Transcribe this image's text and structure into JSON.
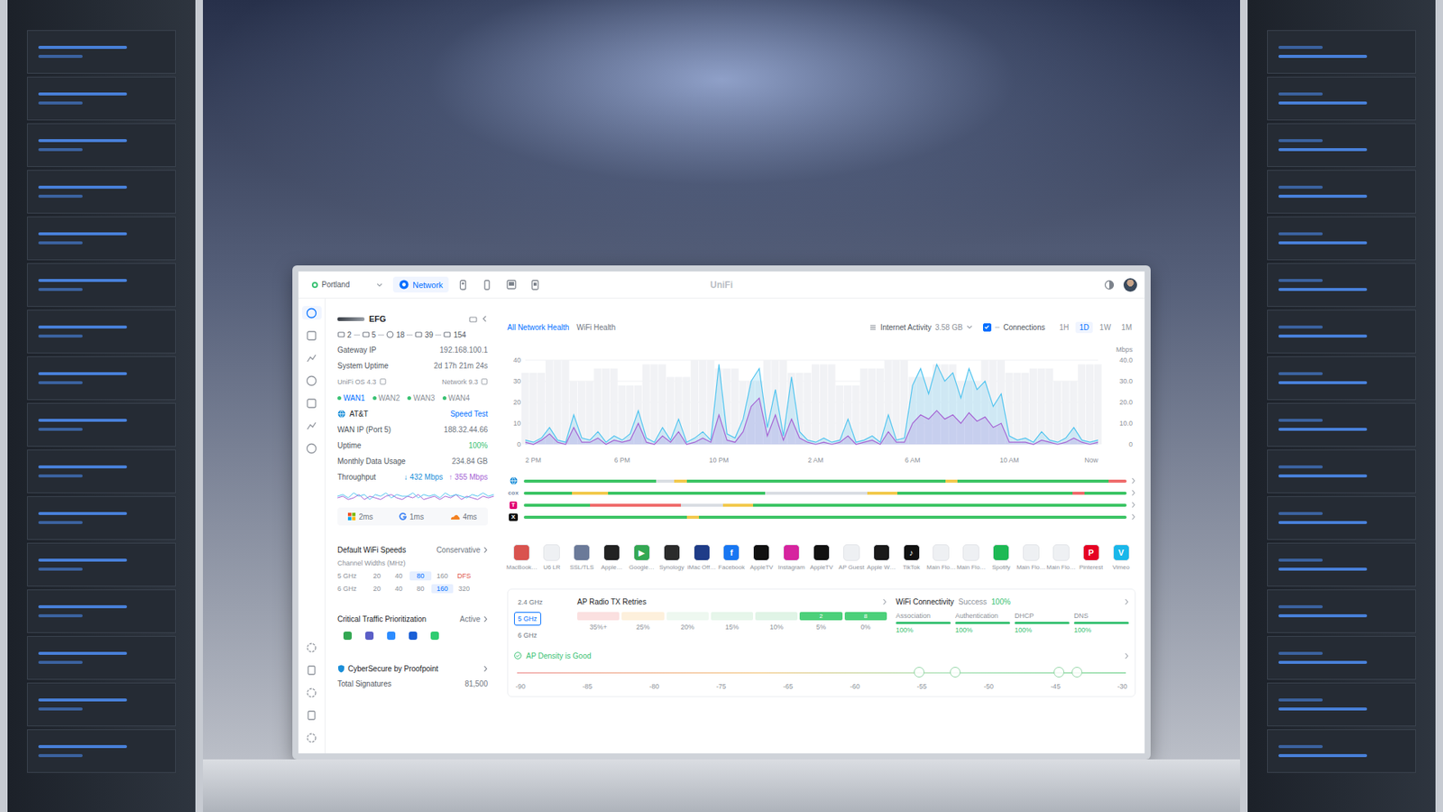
{
  "window": {
    "title": "UniFi"
  },
  "topbar": {
    "site": "Portland",
    "apps": [
      {
        "label": "Network",
        "selected": true
      }
    ],
    "device_tabs": [
      {
        "selected": false
      },
      {
        "selected": false
      },
      {
        "selected": false
      },
      {
        "selected": false
      }
    ]
  },
  "gateway": {
    "name": "EFG",
    "stats": [
      "2",
      "5",
      "18",
      "39",
      "154"
    ],
    "rows": [
      {
        "label": "Gateway IP",
        "value": "192.168.100.1"
      },
      {
        "label": "System Uptime",
        "value": "2d 17h 21m 24s"
      }
    ],
    "os": "UniFi OS 4.3",
    "network": "Network 9.3"
  },
  "wan": {
    "tabs": [
      {
        "label": "WAN1",
        "selected": true
      },
      {
        "label": "WAN2",
        "selected": false
      },
      {
        "label": "WAN3",
        "selected": false
      },
      {
        "label": "WAN4",
        "selected": false
      }
    ],
    "isp": "AT&T",
    "speed_test": "Speed Test",
    "rows": [
      {
        "label": "WAN IP (Port 5)",
        "value": "188.32.44.66",
        "kind": "plain"
      },
      {
        "label": "Uptime",
        "value": "100%",
        "kind": "good"
      },
      {
        "label": "Monthly Data Usage",
        "value": "234.84 GB",
        "kind": "plain"
      }
    ],
    "throughput": {
      "label": "Throughput",
      "down": "↓ 432 Mbps",
      "up": "↑ 355 Mbps",
      "down_history": [
        5,
        6,
        4,
        7,
        5,
        6,
        3,
        6,
        5,
        7,
        4,
        6,
        5,
        5,
        7,
        4,
        6,
        5,
        6,
        4,
        7,
        5,
        6,
        5,
        4,
        6,
        5,
        7,
        5,
        6
      ],
      "up_history": [
        4,
        5,
        3,
        4,
        6,
        3,
        5,
        4,
        3,
        5,
        6,
        4,
        3,
        5,
        4,
        6,
        3,
        4,
        5,
        3,
        5,
        4,
        6,
        3,
        5,
        4,
        3,
        5,
        4,
        5
      ]
    },
    "latency": [
      {
        "value": "2ms",
        "kind": "microsoft"
      },
      {
        "value": "1ms",
        "kind": "google"
      },
      {
        "value": "4ms",
        "kind": "cloudflare"
      }
    ]
  },
  "wifi_speeds": {
    "title": "Default WiFi Speeds",
    "value": "Conservative",
    "subtitle": "Channel Widths (MHz)",
    "bands": [
      {
        "label": "5 GHz",
        "widths": [
          {
            "label": "20",
            "selected": false,
            "kind": "width"
          },
          {
            "label": "40",
            "selected": false,
            "kind": "width"
          },
          {
            "label": "80",
            "selected": true,
            "kind": "width"
          },
          {
            "label": "160",
            "selected": false,
            "kind": "width"
          },
          {
            "label": "DFS",
            "selected": false,
            "kind": "flag"
          }
        ]
      },
      {
        "label": "6 GHz",
        "widths": [
          {
            "label": "20",
            "selected": false,
            "kind": "width"
          },
          {
            "label": "40",
            "selected": false,
            "kind": "width"
          },
          {
            "label": "80",
            "selected": false,
            "kind": "width"
          },
          {
            "label": "160",
            "selected": true,
            "kind": "width"
          },
          {
            "label": "320",
            "selected": false,
            "kind": "width"
          }
        ]
      }
    ]
  },
  "traffic_prioritization": {
    "title": "Critical Traffic Prioritization",
    "value": "Active",
    "apps": [
      {
        "color": "#34a853"
      },
      {
        "color": "#5b5fc7"
      },
      {
        "color": "#2d8cff"
      },
      {
        "color": "#1a5fd6"
      },
      {
        "color": "#2ecc71"
      }
    ]
  },
  "cybersecure": {
    "title": "CyberSecure by Proofpoint",
    "label": "Total Signatures",
    "value": "81,500"
  },
  "health_tabs": [
    {
      "label": "All Network Health",
      "selected": true
    },
    {
      "label": "WiFi Health",
      "selected": false
    }
  ],
  "activity": {
    "label": "Internet Activity",
    "value": "3.58 GB",
    "connections_label": "Connections",
    "connections_checked": true,
    "ranges": [
      {
        "label": "1H",
        "selected": false
      },
      {
        "label": "1D",
        "selected": true
      },
      {
        "label": "1W",
        "selected": false
      },
      {
        "label": "1M",
        "selected": false
      }
    ]
  },
  "chart": {
    "unit": "Mbps",
    "y_ticks": [
      "0",
      "10",
      "20",
      "30",
      "40"
    ],
    "y_ticks_right": [
      "0",
      "10.0",
      "20.0",
      "30.0",
      "40.0"
    ],
    "x_ticks": [
      "2 PM",
      "6 PM",
      "10 PM",
      "2 AM",
      "6 AM",
      "10 AM",
      "Now"
    ],
    "download": {
      "color": "#4cc3ef",
      "values": [
        2,
        1,
        3,
        8,
        2,
        1,
        14,
        3,
        2,
        6,
        1,
        4,
        2,
        5,
        16,
        3,
        1,
        8,
        2,
        12,
        1,
        3,
        6,
        2,
        38,
        5,
        3,
        12,
        30,
        36,
        8,
        26,
        4,
        32,
        6,
        2,
        1,
        3,
        1,
        2,
        12,
        1,
        2,
        4,
        1,
        14,
        2,
        3,
        28,
        36,
        24,
        38,
        30,
        34,
        22,
        36,
        26,
        30,
        18,
        24,
        4,
        2,
        3,
        1,
        6,
        2,
        1,
        3,
        8,
        2,
        1,
        2
      ]
    },
    "upload": {
      "color": "#a45fd3",
      "values": [
        1,
        0,
        2,
        5,
        1,
        0,
        8,
        1,
        1,
        3,
        0,
        2,
        1,
        2,
        10,
        1,
        0,
        4,
        1,
        6,
        0,
        1,
        3,
        1,
        14,
        2,
        1,
        6,
        18,
        22,
        4,
        14,
        2,
        12,
        3,
        1,
        0,
        1,
        0,
        1,
        4,
        0,
        1,
        2,
        0,
        6,
        1,
        1,
        10,
        14,
        12,
        16,
        12,
        14,
        10,
        15,
        11,
        13,
        8,
        10,
        1,
        1,
        1,
        0,
        2,
        1,
        0,
        1,
        3,
        1,
        0,
        1
      ]
    },
    "connections": [
      34,
      34,
      34,
      40,
      40,
      40,
      30,
      30,
      30,
      36,
      36,
      36,
      28,
      28,
      28,
      38,
      38,
      38,
      32,
      32,
      32,
      40,
      40,
      40,
      36,
      36,
      36,
      30,
      30,
      30,
      40,
      40,
      40,
      34,
      34,
      34,
      38,
      38,
      38,
      28,
      28,
      28,
      36,
      36,
      36,
      40,
      40,
      40,
      32,
      32,
      32,
      38,
      38,
      38,
      30,
      30,
      30,
      40,
      40,
      40,
      34,
      34,
      34,
      36,
      36,
      36,
      30,
      30,
      30,
      38,
      38,
      38
    ]
  },
  "providers": [
    {
      "logo": "",
      "kind": "globe",
      "segments": [
        {
          "share": 0.22,
          "color": "#3bc464"
        },
        {
          "share": 0.03,
          "color": "#d9dde3"
        },
        {
          "share": 0.02,
          "color": "#f2c94c"
        },
        {
          "share": 0.43,
          "color": "#3bc464"
        },
        {
          "share": 0.02,
          "color": "#f2c94c"
        },
        {
          "share": 0.25,
          "color": "#3bc464"
        },
        {
          "share": 0.03,
          "color": "#ef6b6b"
        }
      ]
    },
    {
      "logo": "cox",
      "kind": "cox",
      "segments": [
        {
          "share": 0.08,
          "color": "#3bc464"
        },
        {
          "share": 0.06,
          "color": "#f2c94c"
        },
        {
          "share": 0.26,
          "color": "#3bc464"
        },
        {
          "share": 0.17,
          "color": "#d9dde3"
        },
        {
          "share": 0.05,
          "color": "#f2c94c"
        },
        {
          "share": 0.29,
          "color": "#3bc464"
        },
        {
          "share": 0.02,
          "color": "#ef6b6b"
        },
        {
          "share": 0.07,
          "color": "#3bc464"
        }
      ]
    },
    {
      "logo": "T",
      "kind": "tmobile",
      "segments": [
        {
          "share": 0.11,
          "color": "#3bc464"
        },
        {
          "share": 0.15,
          "color": "#ef6b6b"
        },
        {
          "share": 0.07,
          "color": "#d9dde3"
        },
        {
          "share": 0.05,
          "color": "#f2c94c"
        },
        {
          "share": 0.62,
          "color": "#3bc464"
        }
      ]
    },
    {
      "logo": "X",
      "kind": "x",
      "segments": [
        {
          "share": 0.27,
          "color": "#3bc464"
        },
        {
          "share": 0.02,
          "color": "#f2c94c"
        },
        {
          "share": 0.71,
          "color": "#3bc464"
        }
      ]
    }
  ],
  "clients": [
    {
      "label": "MacBook…",
      "color": "#d9534f",
      "glyph": ""
    },
    {
      "label": "U6 LR",
      "color": "#eef0f3",
      "glyph": ""
    },
    {
      "label": "SSL/TLS",
      "color": "#6b7a99",
      "glyph": ""
    },
    {
      "label": "Apple…",
      "color": "#222222",
      "glyph": ""
    },
    {
      "label": "Google…",
      "color": "#34a853",
      "glyph": "▶"
    },
    {
      "label": "Synology",
      "color": "#2b2b2b",
      "glyph": ""
    },
    {
      "label": "iMac Off…",
      "color": "#1f3c88",
      "glyph": ""
    },
    {
      "label": "Facebook",
      "color": "#1877f2",
      "glyph": "f"
    },
    {
      "label": "AppleTV",
      "color": "#111111",
      "glyph": ""
    },
    {
      "label": "Instagram",
      "color": "#d6249f",
      "glyph": ""
    },
    {
      "label": "AppleTV",
      "color": "#111111",
      "glyph": ""
    },
    {
      "label": "AP Guest",
      "color": "#eef0f3",
      "glyph": ""
    },
    {
      "label": "Apple W…",
      "color": "#1a1a1a",
      "glyph": ""
    },
    {
      "label": "TikTok",
      "color": "#111111",
      "glyph": "♪"
    },
    {
      "label": "Main Flo…",
      "color": "#eef0f3",
      "glyph": ""
    },
    {
      "label": "Main Flo…",
      "color": "#eef0f3",
      "glyph": ""
    },
    {
      "label": "Spotify",
      "color": "#1db954",
      "glyph": ""
    },
    {
      "label": "Main Flo…",
      "color": "#eef0f3",
      "glyph": ""
    },
    {
      "label": "Main Flo…",
      "color": "#eef0f3",
      "glyph": ""
    },
    {
      "label": "Pinterest",
      "color": "#e60023",
      "glyph": "P"
    },
    {
      "label": "Vimeo",
      "color": "#1ab7ea",
      "glyph": "V"
    }
  ],
  "radio": {
    "bands": [
      {
        "label": "2.4 GHz",
        "selected": false
      },
      {
        "label": "5 GHz",
        "selected": true
      },
      {
        "label": "6 GHz",
        "selected": false
      }
    ],
    "retries": {
      "title": "AP Radio TX Retries",
      "buckets": [
        {
          "label": "35%+",
          "count": "",
          "color": "#fbe0e0"
        },
        {
          "label": "25%",
          "count": "",
          "color": "#fdf0dc"
        },
        {
          "label": "20%",
          "count": "",
          "color": "#eef8f0"
        },
        {
          "label": "15%",
          "count": "",
          "color": "#e6f6ea"
        },
        {
          "label": "10%",
          "count": "",
          "color": "#e0f4e6"
        },
        {
          "label": "5%",
          "count": "2",
          "color": "#4cd07a"
        },
        {
          "label": "0%",
          "count": "8",
          "color": "#4cd07a"
        }
      ]
    }
  },
  "connectivity": {
    "title": "WiFi Connectivity",
    "status_label": "Success",
    "status_value": "100%",
    "steps": [
      {
        "label": "Association",
        "value": "100%",
        "level": 1
      },
      {
        "label": "Authentication",
        "value": "100%",
        "level": 1
      },
      {
        "label": "DHCP",
        "value": "100%",
        "level": 1
      },
      {
        "label": "DNS",
        "value": "100%",
        "level": 1
      }
    ]
  },
  "density": {
    "label": "AP Density is Good",
    "scale": [
      "-90",
      "-85",
      "-80",
      "-75",
      "-65",
      "-60",
      "-55",
      "-50",
      "-45",
      "-30"
    ],
    "aps": [
      {
        "level": 0.66
      },
      {
        "level": 0.72
      },
      {
        "level": 0.89
      },
      {
        "level": 0.92
      }
    ]
  }
}
